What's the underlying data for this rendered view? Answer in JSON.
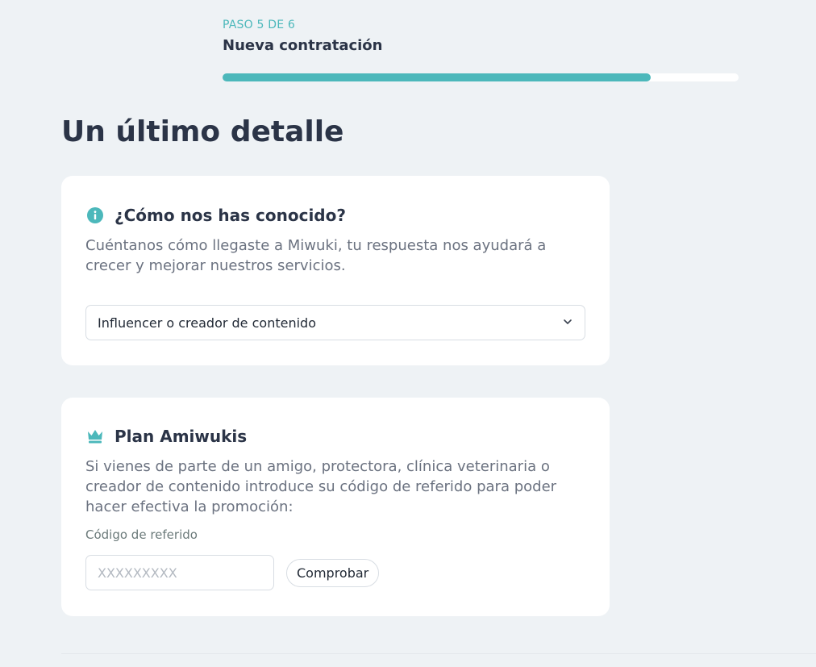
{
  "step": {
    "label": "PASO 5 DE 6",
    "title": "Nueva contratación",
    "progress": 0.83
  },
  "main_title": "Un último detalle",
  "how_found": {
    "icon": "info-icon",
    "title": "¿Cómo nos has conocido?",
    "description": "Cuéntanos cómo llegaste a Miwuki, tu respuesta nos ayudará a crecer y mejorar nuestros servicios.",
    "selected_option": "Influencer o creador de contenido"
  },
  "plan": {
    "icon": "crown-icon",
    "title": "Plan Amiwukis",
    "description": "Si vienes de parte de un amigo, protectora, clínica veterinaria o creador de contenido introduce su código de referido para poder hacer efectiva la promoción:",
    "field_label": "Código de referido",
    "input_placeholder": "XXXXXXXXX",
    "input_value": "",
    "check_button_label": "Comprobar"
  },
  "colors": {
    "accent": "#4cb8bb",
    "background": "#eef2f5",
    "heading": "#2b3447"
  }
}
